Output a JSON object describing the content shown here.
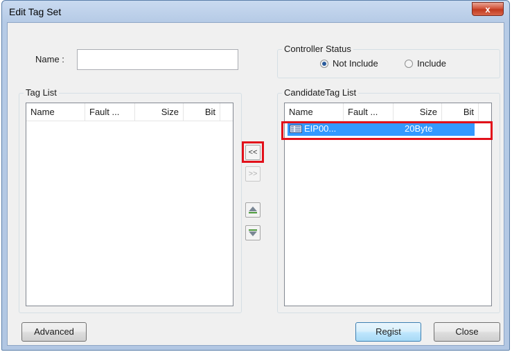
{
  "window": {
    "title": "Edit Tag Set",
    "close_glyph": "x"
  },
  "name_field": {
    "label": "Name :",
    "value": ""
  },
  "controller_status": {
    "title": "Controller Status",
    "options": [
      {
        "label": "Not Include",
        "selected": true
      },
      {
        "label": "Include",
        "selected": false
      }
    ]
  },
  "tag_list": {
    "title": "Tag List",
    "columns": [
      "Name",
      "Fault ...",
      "Size",
      "Bit"
    ],
    "rows": []
  },
  "candidate_tag_list": {
    "title": "CandidateTag List",
    "columns": [
      "Name",
      "Fault ...",
      "Size",
      "Bit"
    ],
    "rows": [
      {
        "name": "EIP00...",
        "fault": "",
        "size": "20Byte",
        "bit": "",
        "icon": "tag-struct-icon",
        "selected": true
      }
    ]
  },
  "transfer_buttons": {
    "move_left": "<<",
    "move_right": ">>"
  },
  "order_buttons": {
    "up_icon": "move-up-icon",
    "down_icon": "move-down-icon"
  },
  "buttons": {
    "advanced": "Advanced",
    "regist": "Regist",
    "close": "Close"
  },
  "colors": {
    "highlight": "#e2101a",
    "selection": "#3399ff"
  }
}
